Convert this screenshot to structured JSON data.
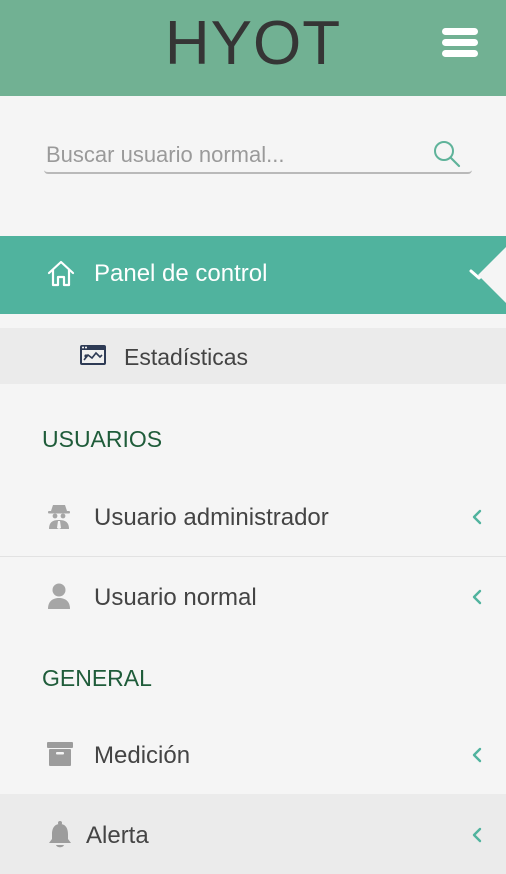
{
  "header": {
    "brand": "HYOT",
    "menu_icon": "hamburger-menu-icon",
    "color": "#71b193"
  },
  "search": {
    "placeholder": "Buscar usuario normal...",
    "value": "",
    "icon": "search-icon"
  },
  "nav": {
    "active": {
      "label": "Panel de control",
      "icon": "home-icon",
      "color": "#50b39e"
    },
    "sub_items": [
      {
        "label": "Estadísticas",
        "icon": "stats-window-icon"
      }
    ],
    "sections": [
      {
        "title": "USUARIOS",
        "items": [
          {
            "label": "Usuario administrador",
            "icon": "spy-user-icon"
          },
          {
            "label": "Usuario normal",
            "icon": "user-icon"
          }
        ]
      },
      {
        "title": "GENERAL",
        "items": [
          {
            "label": "Medición",
            "icon": "archive-box-icon"
          },
          {
            "label": "Alerta",
            "icon": "bell-icon"
          }
        ]
      }
    ]
  }
}
